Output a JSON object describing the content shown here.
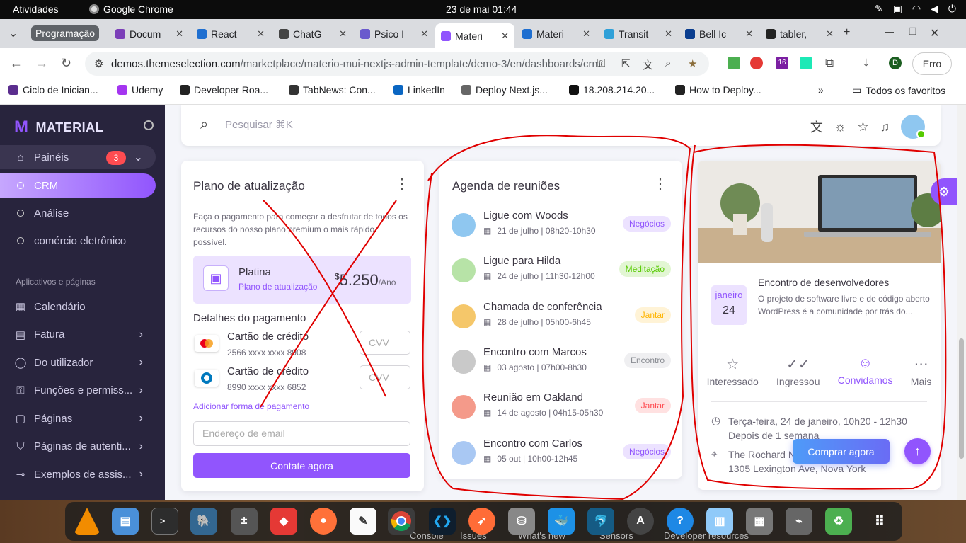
{
  "os_bar": {
    "activities": "Atividades",
    "app": "Google Chrome",
    "clock": "23 de mai  01:44"
  },
  "tabs": {
    "group_label": "Programação",
    "items": [
      {
        "label": "Docum",
        "color": "#7b3fb8"
      },
      {
        "label": "React",
        "color": "#1f6fd0"
      },
      {
        "label": "ChatG",
        "color": "#444444"
      },
      {
        "label": "Psico I",
        "color": "#6a5acd"
      },
      {
        "label": "Materi",
        "color": "#9155fd"
      },
      {
        "label": "Materi",
        "color": "#1f6fd0"
      },
      {
        "label": "Transit",
        "color": "#2fa0d8"
      },
      {
        "label": "Bell Ic",
        "color": "#0a3d8f"
      },
      {
        "label": "tabler,",
        "color": "#222222"
      }
    ]
  },
  "address": {
    "domain": "demos.themeselection.com",
    "path": "/marketplace/materio-mui-nextjs-admin-template/demo-3/en/dashboards/crm",
    "profile_initial": "D",
    "extension_badge": "16",
    "error_label": "Erro"
  },
  "bookmarks": {
    "items": [
      "Ciclo de Inician...",
      "Udemy",
      "Developer Roa...",
      "TabNews: Con...",
      "LinkedIn",
      "Deploy Next.js...",
      "18.208.214.20...",
      "How to Deploy..."
    ],
    "overflow": "»",
    "all_label": "Todos os favoritos"
  },
  "sidebar": {
    "brand": "MATERIAL",
    "dashboards": "Painéis",
    "dashboards_badge": "3",
    "sub_items": [
      "CRM",
      "Análise",
      "comércio eletrônico"
    ],
    "section": "Aplicativos e páginas",
    "items": [
      {
        "label": "Calendário",
        "icon": "calendar-icon",
        "chevron": false
      },
      {
        "label": "Fatura",
        "icon": "invoice-icon",
        "chevron": true
      },
      {
        "label": "Do utilizador",
        "icon": "user-icon",
        "chevron": true
      },
      {
        "label": "Funções e permiss...",
        "icon": "lock-icon",
        "chevron": true
      },
      {
        "label": "Páginas",
        "icon": "pages-icon",
        "chevron": true
      },
      {
        "label": "Páginas de autenti...",
        "icon": "shield-icon",
        "chevron": true
      },
      {
        "label": "Exemplos de assis...",
        "icon": "wizard-icon",
        "chevron": true
      }
    ]
  },
  "search": {
    "placeholder": "Pesquisar ⌘K"
  },
  "upgrade_card": {
    "title": "Plano de atualização",
    "description": "Faça o pagamento para começar a desfrutar de todos os recursos do nosso plano premium o mais rápido possível.",
    "plan_name": "Platina",
    "plan_link": "Plano de atualização",
    "price_currency": "$",
    "price": "5.250",
    "price_period": "/Ano",
    "payment_title": "Detalhes do pagamento",
    "cards": [
      {
        "name": "Cartão de crédito",
        "number": "2566 xxxx xxxx 8908",
        "cvv_placeholder": "CVV",
        "brand": "mastercard"
      },
      {
        "name": "Cartão de crédito",
        "number": "8990 xxxx xxxx 6852",
        "cvv_placeholder": "CVV",
        "brand": "diners"
      }
    ],
    "add_payment": "Adicionar forma de pagamento",
    "email_placeholder": "Endereço de email",
    "contact_button": "Contate agora"
  },
  "meetings_card": {
    "title": "Agenda de reuniões",
    "items": [
      {
        "title": "Ligue com Woods",
        "date": "21 de julho | 08h20-10h30",
        "tag": "Negócios",
        "tag_bg": "#ece2ff",
        "tag_fg": "#9155fd",
        "avatar": "#8fc7f0"
      },
      {
        "title": "Ligue para Hilda",
        "date": "24 de julho | 11h30-12h00",
        "tag": "Meditação",
        "tag_bg": "#e2f6d3",
        "tag_fg": "#56ca00",
        "avatar": "#b7e3a7"
      },
      {
        "title": "Chamada de conferência",
        "date": "28 de julho | 05h00-6h45",
        "tag": "Jantar",
        "tag_bg": "#fff3d6",
        "tag_fg": "#ffb400",
        "avatar": "#f5c76a"
      },
      {
        "title": "Encontro com Marcos",
        "date": "03 agosto | 07h00-8h30",
        "tag": "Encontro",
        "tag_bg": "#efeff1",
        "tag_fg": "#8a8d93",
        "avatar": "#c9c9c9"
      },
      {
        "title": "Reunião em Oakland",
        "date": "14 de agosto | 04h15-05h30",
        "tag": "Jantar",
        "tag_bg": "#ffe1e1",
        "tag_fg": "#ff4c51",
        "avatar": "#f49a8a"
      },
      {
        "title": "Encontro com Carlos",
        "date": "05 out | 10h00-12h45",
        "tag": "Negócios",
        "tag_bg": "#ece2ff",
        "tag_fg": "#9155fd",
        "avatar": "#a9c8f3"
      }
    ]
  },
  "event_card": {
    "month": "janeiro",
    "day": "24",
    "title": "Encontro de desenvolvedores",
    "description": "O projeto de software livre e de código aberto WordPress é a comunidade por trás do...",
    "actions": [
      {
        "label": "Interessado",
        "icon": "star-icon",
        "active": false
      },
      {
        "label": "Ingressou",
        "icon": "double-check-icon",
        "active": false
      },
      {
        "label": "Convidamos",
        "icon": "users-icon",
        "active": true
      },
      {
        "label": "Mais",
        "icon": "more-icon",
        "active": false
      }
    ],
    "datetime": "Terça-feira, 24 de janeiro, 10h20 - 12h30",
    "relative": "Depois de 1 semana",
    "place": "The Rochard N",
    "address": "1305 Lexington Ave, Nova York"
  },
  "buy_button": "Comprar agora",
  "devtools_strip": [
    "Console",
    "Issues",
    "What's new",
    "Sensors",
    "Developer resources"
  ],
  "colors": {
    "primary": "#9155fd",
    "sidebar_bg": "#28243d",
    "annotation_red": "#e00000"
  }
}
